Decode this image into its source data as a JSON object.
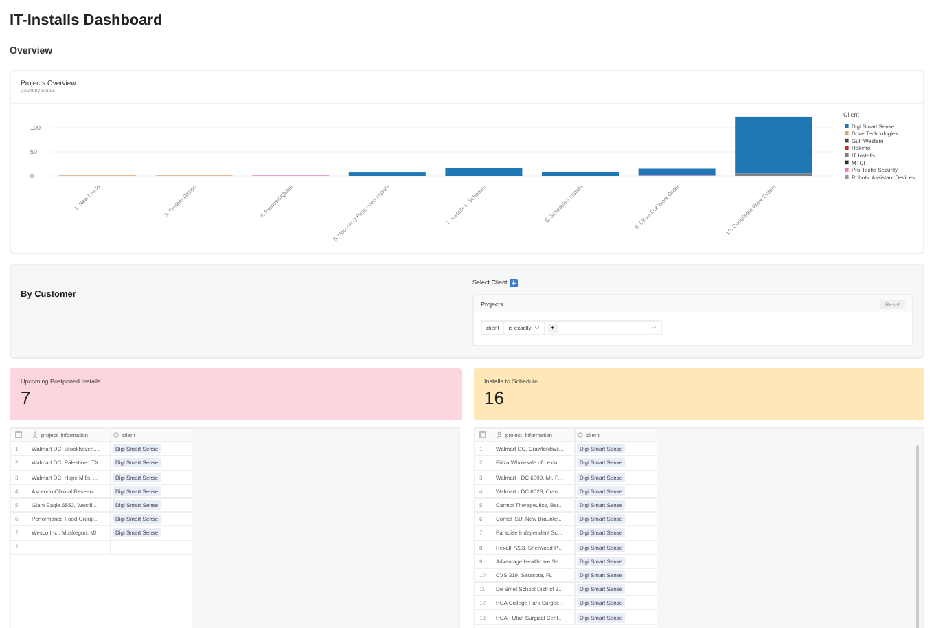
{
  "title": "IT-Installs Dashboard",
  "section": "Overview",
  "chart_card": {
    "title": "Projects Overview",
    "subtitle": "Count by Status",
    "chart_data": {
      "type": "bar",
      "stacked": true,
      "orientation": "vertical",
      "yticks": [
        0,
        50,
        100
      ],
      "ylim": [
        0,
        125
      ],
      "legend": "right",
      "categories": [
        "1. New Leads",
        "3. System Design",
        "4. Proposal/Quote",
        "6. Upcoming Postponed Installs",
        "7. Installs to Schedule",
        "8. Scheduled Installs",
        "9. Close Out Work Order",
        "10. Completed Work Orders"
      ],
      "legend_title": "Client",
      "series": [
        {
          "name": "Digi Smart Sense",
          "color": "#1f77b4",
          "values": [
            0,
            0,
            0,
            7,
            16,
            8,
            14,
            118
          ]
        },
        {
          "name": "Dove Technologies",
          "color": "#d9a070",
          "values": [
            1,
            1,
            0,
            0,
            0,
            0,
            0,
            0
          ]
        },
        {
          "name": "Gulf Western",
          "color": "#444444",
          "values": [
            0,
            0,
            0,
            0,
            0,
            0,
            0,
            0
          ]
        },
        {
          "name": "Hakimo",
          "color": "#d62728",
          "values": [
            0,
            0,
            0,
            0,
            0,
            0,
            0,
            0
          ]
        },
        {
          "name": "IT Installs",
          "color": "#7f7f7f",
          "values": [
            0,
            0,
            0,
            0,
            0,
            0,
            0,
            5
          ]
        },
        {
          "name": "MTCI",
          "color": "#3b2a1a",
          "values": [
            0,
            0,
            0,
            0,
            0,
            0,
            0,
            0
          ]
        },
        {
          "name": "Pro-Techs Security",
          "color": "#e377c2",
          "values": [
            0,
            0,
            1,
            0,
            0,
            0,
            1,
            0
          ]
        },
        {
          "name": "Robotic Assistant Devices",
          "color": "#999999",
          "values": [
            0,
            0,
            0,
            0,
            0,
            0,
            0,
            0
          ]
        }
      ]
    }
  },
  "by_customer": {
    "title": "By Customer",
    "select_label": "Select Client",
    "filter_title": "Projects",
    "reset": "Reset",
    "field": "client",
    "operator": "is exactly",
    "add": "+"
  },
  "kpis": [
    {
      "label": "Upcoming Postponed Installs",
      "value": "7",
      "color": "#fdd5de"
    },
    {
      "label": "Installs to Schedule",
      "value": "16",
      "color": "#fee8b8"
    }
  ],
  "tables": [
    {
      "select_all_checked": false,
      "columns": [
        "",
        "project_information",
        "client"
      ],
      "add_row": "+",
      "rows": [
        [
          "1",
          "Walmart DC, Brookhaven,...",
          "Digi Smart Sense"
        ],
        [
          "2",
          "Walmart DC, Palestine , TX",
          "Digi Smart Sense"
        ],
        [
          "3",
          "Walmart DC, Hope Mills, ...",
          "Digi Smart Sense"
        ],
        [
          "4",
          "Ascendo Clinical Researc...",
          "Digi Smart Sense"
        ],
        [
          "5",
          "Giant Eagle 6552, Westfi...",
          "Digi Smart Sense"
        ],
        [
          "6",
          "Performance Food Group...",
          "Digi Smart Sense"
        ],
        [
          "7",
          "Wesco Inc., Muskegon, MI",
          "Digi Smart Sense"
        ]
      ]
    },
    {
      "select_all_checked": false,
      "columns": [
        "",
        "project_information",
        "client"
      ],
      "scrollbar": true,
      "rows": [
        [
          "1",
          "Walmart DC, Crawfordsvil...",
          "Digi Smart Sense"
        ],
        [
          "2",
          "Pizza Wholesale of Lexin...",
          "Digi Smart Sense"
        ],
        [
          "3",
          "Walmart - DC 6009, Mt. P...",
          "Digi Smart Sense"
        ],
        [
          "4",
          "Walmart - DC 6028, Craw...",
          "Digi Smart Sense"
        ],
        [
          "5",
          "Carmot Therapeutics, Ber...",
          "Digi Smart Sense"
        ],
        [
          "6",
          "Comal ISD, New Braunfel...",
          "Digi Smart Sense"
        ],
        [
          "7",
          "Paradise Independent Sc...",
          "Digi Smart Sense"
        ],
        [
          "8",
          "Rexall 7233, Sherwood P...",
          "Digi Smart Sense"
        ],
        [
          "9",
          "Advantage Healthcare Se...",
          "Digi Smart Sense"
        ],
        [
          "10",
          "CVS 319, Sarasota, FL",
          "Digi Smart Sense"
        ],
        [
          "11",
          "De Smet School District 3...",
          "Digi Smart Sense"
        ],
        [
          "12",
          "HCA College Park Surger...",
          "Digi Smart Sense"
        ],
        [
          "13",
          "HCA - Utah Surgical Cent...",
          "Digi Smart Sense"
        ]
      ]
    }
  ]
}
